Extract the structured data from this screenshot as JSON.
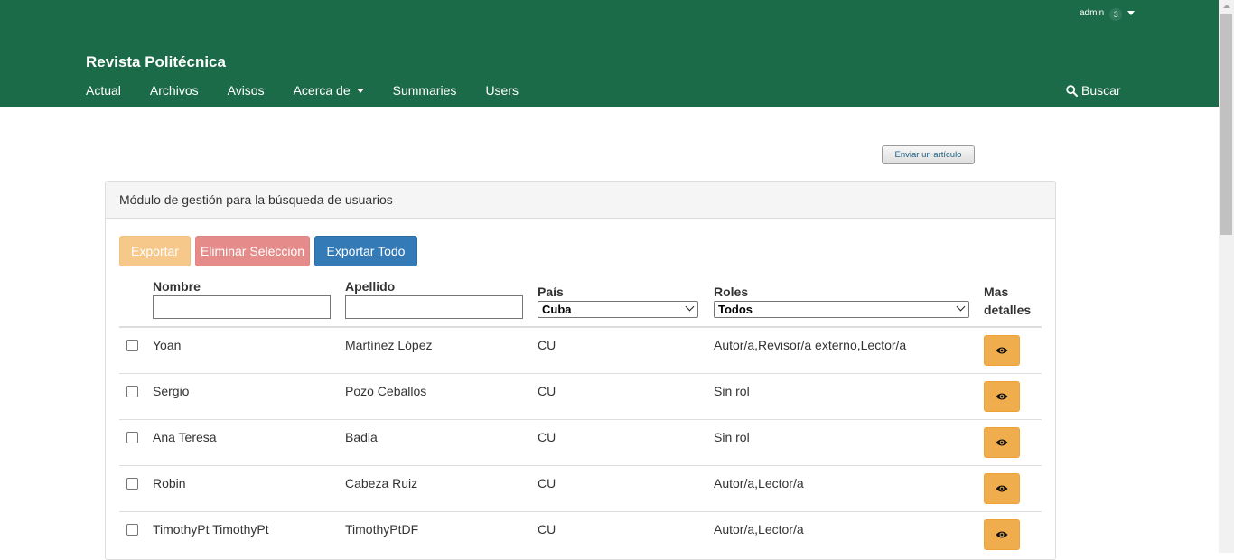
{
  "header": {
    "user": "admin",
    "notifications": "3",
    "site_title": "Revista Politécnica",
    "nav": [
      "Actual",
      "Archivos",
      "Avisos",
      "Acerca de",
      "Summaries",
      "Users"
    ],
    "search_label": "Buscar",
    "bg_color": "#1b6b48"
  },
  "submit_label": "Enviar un artículo",
  "panel": {
    "title": "Módulo de gestión para la búsqueda de usuarios",
    "buttons": {
      "export": "Exportar",
      "delete_selection": "Eliminar Selección",
      "export_all": "Exportar Todo"
    },
    "columns": {
      "nombre": "Nombre",
      "apellido": "Apellido",
      "pais": "País",
      "roles": "Roles",
      "mas_line1": "Mas",
      "mas_line2": "detalles"
    },
    "filters": {
      "nombre_value": "",
      "apellido_value": "",
      "pais_selected": "Cuba",
      "roles_selected": "Todos"
    },
    "rows": [
      {
        "nombre": "Yoan",
        "apellido": "Martínez López",
        "pais": "CU",
        "roles": "Autor/a,Revisor/a externo,Lector/a"
      },
      {
        "nombre": "Sergio",
        "apellido": "Pozo Ceballos",
        "pais": "CU",
        "roles": "Sin rol"
      },
      {
        "nombre": "Ana Teresa",
        "apellido": "Badia",
        "pais": "CU",
        "roles": "Sin rol"
      },
      {
        "nombre": "Robin",
        "apellido": "Cabeza Ruiz",
        "pais": "CU",
        "roles": "Autor/a,Lector/a"
      },
      {
        "nombre": "TimothyPt TimothyPt",
        "apellido": "TimothyPtDF",
        "pais": "CU",
        "roles": "Autor/a,Lector/a"
      }
    ]
  },
  "icons": {
    "search": "search-icon",
    "details": "eye-icon",
    "dropdown": "chevron-down-icon"
  }
}
